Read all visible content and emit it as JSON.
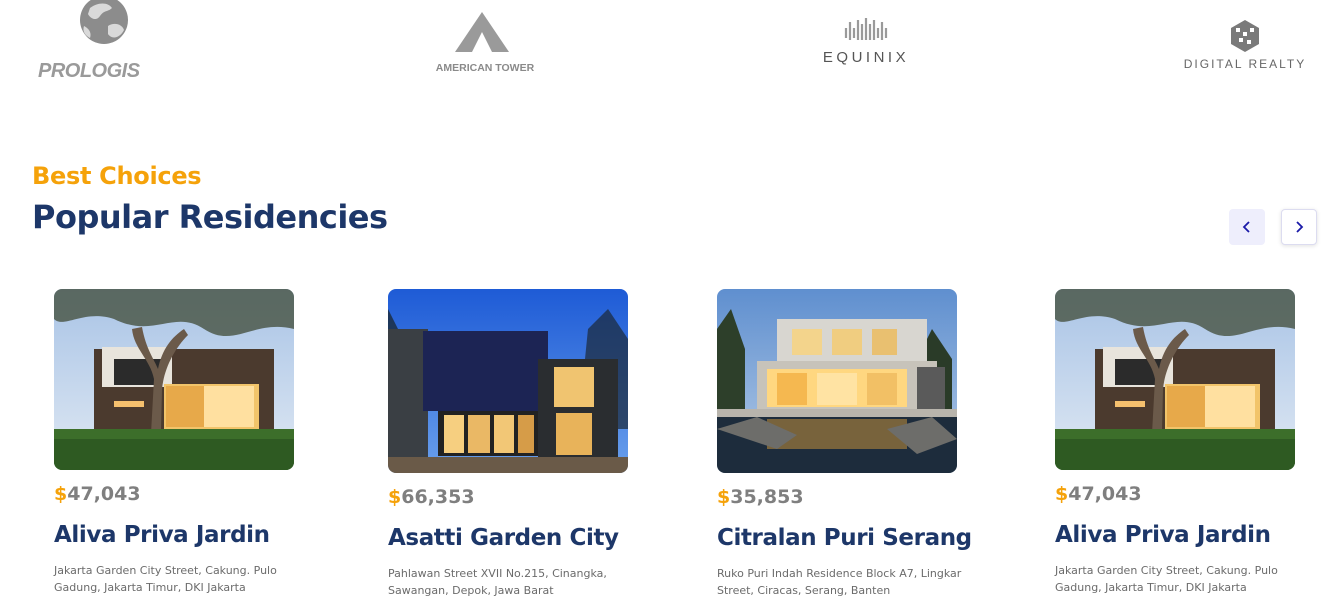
{
  "partners": [
    {
      "name": "PROLOGIS",
      "icon": "prologis-globe-icon"
    },
    {
      "name": "AMERICAN TOWER",
      "icon": "american-tower-triangle-icon"
    },
    {
      "name": "EQUINIX",
      "icon": "equinix-waves-icon"
    },
    {
      "name": "DIGITAL REALTY",
      "icon": "digital-realty-cube-icon"
    }
  ],
  "section": {
    "eyebrow": "Best Choices",
    "title": "Popular Residencies",
    "prev_icon": "chevron-left-icon",
    "next_icon": "chevron-right-icon"
  },
  "colors": {
    "accent": "#f5a20a",
    "heading": "#1d3769",
    "price_text": "#7f7f7f",
    "address_text": "#6b6b6b",
    "prev_button_bg": "#eeeefc",
    "arrow": "#1a1aa8"
  },
  "residencies": [
    {
      "currency": "$",
      "price": "47,043",
      "name": "Aliva Priva Jardin",
      "address": "Jakarta Garden City Street, Cakung. Pulo Gadung, Jakarta Timur, DKI Jakarta",
      "photo": "modern-house-with-tree-photo"
    },
    {
      "currency": "$",
      "price": "66,353",
      "name": "Asatti Garden City",
      "address": "Pahlawan Street XVII No.215, Cinangka, Sawangan, Depok, Jawa Barat",
      "photo": "modern-house-at-dusk-photo"
    },
    {
      "currency": "$",
      "price": "35,853",
      "name": "Citralan Puri Serang",
      "address": "Ruko Puri Indah Residence Block A7, Lingkar Street, Ciracas, Serang, Banten",
      "photo": "modern-house-with-pond-photo"
    },
    {
      "currency": "$",
      "price": "47,043",
      "name": "Aliva Priva Jardin",
      "address": "Jakarta Garden City Street, Cakung. Pulo Gadung, Jakarta Timur, DKI Jakarta",
      "photo": "modern-house-with-tree-photo"
    }
  ]
}
